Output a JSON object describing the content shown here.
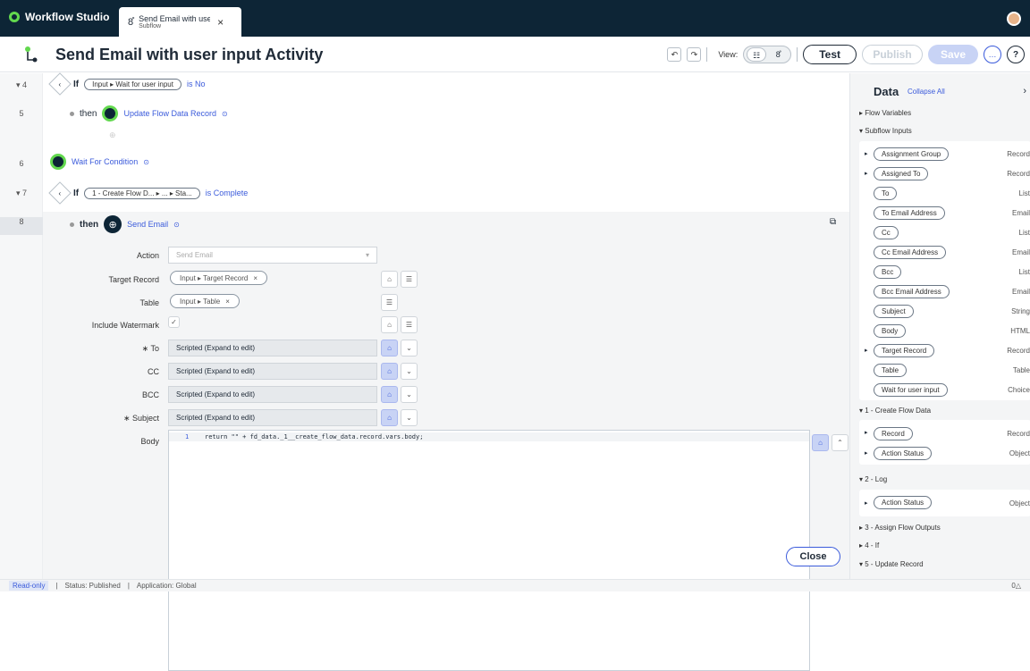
{
  "topbar": {
    "home_tab": "Workflow Studio",
    "active_tab": {
      "title": "Send Email with user input Activity",
      "type": "Subflow"
    }
  },
  "header": {
    "title": "Send Email with user input Activity",
    "view_label": "View:",
    "test": "Test",
    "publish": "Publish",
    "save": "Save",
    "more": "…",
    "help": "?"
  },
  "flow": {
    "rows": [
      {
        "num": "4",
        "collapse": "▾"
      },
      {
        "num": "5"
      },
      {
        "num": "6"
      },
      {
        "num": "7",
        "collapse": "▾"
      },
      {
        "num": "8"
      }
    ],
    "if4": {
      "kw": "If",
      "pill": "Input ▸ Wait for user input",
      "cond": "is No"
    },
    "then5": {
      "kw": "then",
      "action": "Update Flow Data Record"
    },
    "wait6": {
      "action": "Wait For Condition"
    },
    "if7": {
      "kw": "If",
      "pill": "1 - Create Flow D... ▸ ... ▸ Sta...",
      "cond": "is Complete"
    },
    "then8": {
      "kw": "then",
      "action": "Send Email"
    }
  },
  "form": {
    "action_label": "Action",
    "action_value": "Send Email",
    "target_label": "Target Record",
    "target_pill": "Input ▸ Target Record",
    "table_label": "Table",
    "table_pill": "Input ▸ Table",
    "watermark_label": "Include Watermark",
    "to_label": "∗ To",
    "to_value": "Scripted (Expand to edit)",
    "cc_label": "CC",
    "cc_value": "Scripted (Expand to edit)",
    "bcc_label": "BCC",
    "bcc_value": "Scripted (Expand to edit)",
    "subject_label": "∗ Subject",
    "subject_value": "Scripted (Expand to edit)",
    "body_label": "Body",
    "code_line_num": "1",
    "code": "return \"\" + fd_data._1__create_flow_data.record.vars.body;",
    "close": "Close"
  },
  "data_panel": {
    "title": "Data",
    "collapse_all": "Collapse All",
    "flow_variables": "▸ Flow Variables",
    "subflow_inputs": "▾ Subflow Inputs",
    "inputs": [
      {
        "name": "Assignment Group",
        "type": "Record",
        "arrow": "▸"
      },
      {
        "name": "Assigned To",
        "type": "Record",
        "arrow": "▸"
      },
      {
        "name": "To",
        "type": "List",
        "arrow": ""
      },
      {
        "name": "To Email Address",
        "type": "Email",
        "arrow": ""
      },
      {
        "name": "Cc",
        "type": "List",
        "arrow": ""
      },
      {
        "name": "Cc Email Address",
        "type": "Email",
        "arrow": ""
      },
      {
        "name": "Bcc",
        "type": "List",
        "arrow": ""
      },
      {
        "name": "Bcc Email Address",
        "type": "Email",
        "arrow": ""
      },
      {
        "name": "Subject",
        "type": "String",
        "arrow": ""
      },
      {
        "name": "Body",
        "type": "HTML",
        "arrow": ""
      },
      {
        "name": "Target Record",
        "type": "Record",
        "arrow": "▸"
      },
      {
        "name": "Table",
        "type": "Table",
        "arrow": ""
      },
      {
        "name": "Wait for user input",
        "type": "Choice",
        "arrow": ""
      }
    ],
    "sec1": "▾ 1 - Create Flow Data",
    "sec1_items": [
      {
        "name": "Record",
        "type": "Record"
      },
      {
        "name": "Action Status",
        "type": "Object"
      }
    ],
    "sec2": "▾ 2 - Log",
    "sec2_items": [
      {
        "name": "Action Status",
        "type": "Object"
      }
    ],
    "sec3": "▸ 3 - Assign Flow Outputs",
    "sec4": "▸ 4 - If",
    "sec5": "▾ 5 - Update Record"
  },
  "status": {
    "readonly": "Read-only",
    "status": "Status: Published",
    "application": "Application: Global",
    "right": "0△"
  }
}
